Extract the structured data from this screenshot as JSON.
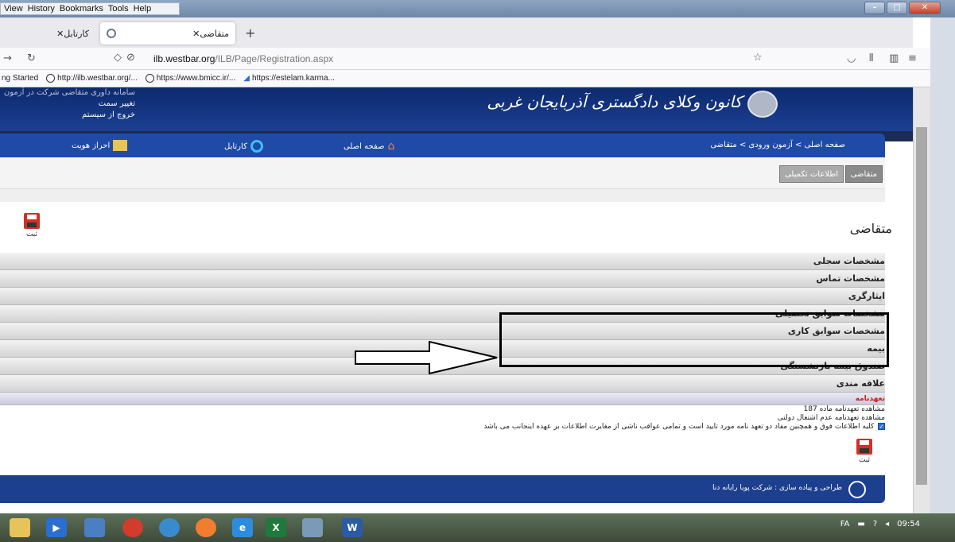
{
  "browser": {
    "menu": [
      "View",
      "History",
      "Bookmarks",
      "Tools",
      "Help"
    ],
    "tabs": [
      {
        "label": "کارتابل"
      },
      {
        "label": "متقاضی",
        "active": true
      }
    ],
    "url_host": "ilb.westbar.org",
    "url_path": "/ILB/Page/Registration.aspx",
    "bookmarks": [
      "ng Started",
      "http://ilb.westbar.org/...",
      "https://www.bmicc.ir/...",
      "https://estelam.karma..."
    ]
  },
  "site": {
    "title": "کانون وکلای دادگستری آذربایجان غربی",
    "user_links": [
      "سامانه داوری متقاضی شرکت در آزمون",
      "تغییر سمت",
      "خروج از سیستم"
    ],
    "nav": {
      "home": "صفحه اصلی",
      "inbox": "کارتابل",
      "identity": "احراز هویت"
    },
    "breadcrumb": "صفحه اصلی > آزمون ورودی > متقاضی",
    "tabs": {
      "active": "متقاضی",
      "other": "اطلاعات تکمیلی"
    },
    "save_label": "ثبت",
    "section_title": "متقاضی",
    "accordion": [
      "مشخصات سجلی",
      "مشخصات تماس",
      "ایثارگری",
      "مشخصات سوابق تحصیلی",
      "مشخصات سوابق کاری",
      "بیمه",
      "صندوق بیمه بازنشستگی",
      "علاقه مندی",
      "تعهدنامه"
    ],
    "commitments": [
      "مشاهده تعهدنامه ماده 187",
      "مشاهده تعهدنامه عدم اشتغال دولتی",
      "کلیه اطلاعات فوق و همچنین مفاد دو تعهد نامه مورد تایید است و تمامی عواقب ناشی از مغایرت اطلاعات بر عهده اینجانب می باشد"
    ],
    "footer": "طراحی و پیاده سازی : شرکت پویا رایانه دنا"
  },
  "taskbar": {
    "lang": "FA",
    "time": "09:54"
  },
  "colors": {
    "banner": "#1c3f93",
    "nav_strip": "#1f4aa7",
    "save_red": "#d1302a"
  }
}
